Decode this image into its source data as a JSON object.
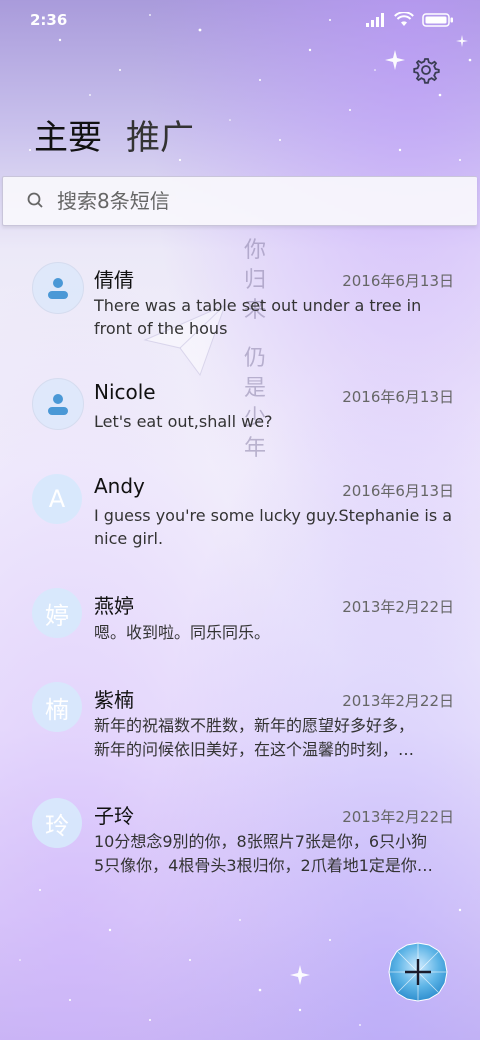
{
  "status_bar": {
    "time": "2:36"
  },
  "header": {
    "tabs": [
      {
        "label": "主要"
      },
      {
        "label": "推广"
      }
    ]
  },
  "search": {
    "placeholder": "搜索8条短信"
  },
  "background_poem": {
    "chars": [
      "你",
      "归",
      "来",
      "仍",
      "是",
      "少",
      "年"
    ]
  },
  "conversations": [
    {
      "name": "倩倩",
      "avatar": "",
      "date": "2016年6月13日",
      "message": "There was a table set out under a tree in front of the hous"
    },
    {
      "name": "Nicole",
      "avatar": "",
      "date": "2016年6月13日",
      "message": "Let's eat out,shall we?"
    },
    {
      "name": "Andy",
      "avatar": "A",
      "date": "2016年6月13日",
      "message": "I guess you're some lucky guy.Stephanie is a nice girl."
    },
    {
      "name": "燕婷",
      "avatar": "婷",
      "date": "2013年2月22日",
      "message": "嗯。收到啦。同乐同乐。"
    },
    {
      "name": "紫楠",
      "avatar": "楠",
      "date": "2013年2月22日",
      "message_line1": "新年的祝福数不胜数，新年的愿望好多好多，",
      "message_line2": "新年的问候依旧美好，在这个温馨的时刻，…"
    },
    {
      "name": "子玲",
      "avatar": "玲",
      "date": "2013年2月22日",
      "message_line1": "10分想念9別的你，8张照片7张是你，6只小狗",
      "message_line2": "5只像你，4根骨头3根归你，2爪着地1定是你…"
    }
  ],
  "colors": {
    "accent": "#3a8fc9",
    "avatar_bg": "#d7e8fc",
    "fab": "#4aa3d8"
  }
}
